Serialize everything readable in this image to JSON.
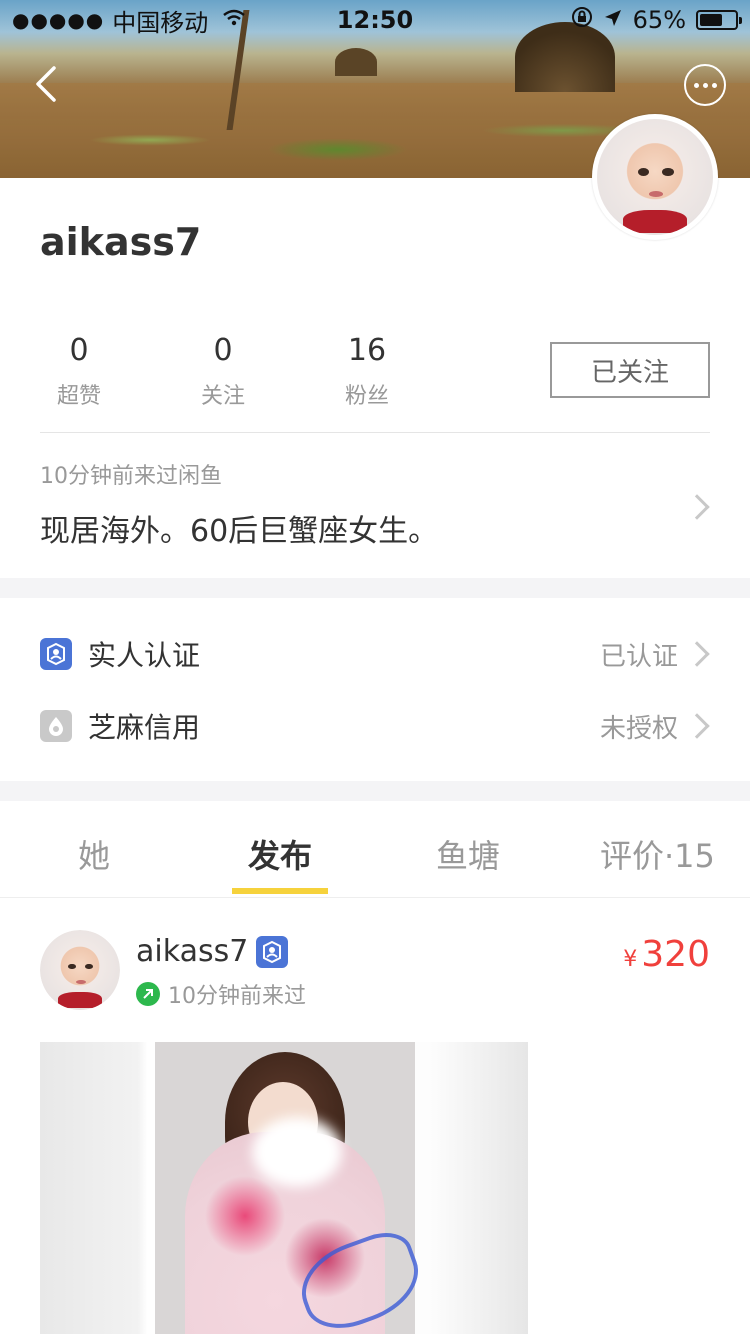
{
  "status_bar": {
    "signal": "●●●●●",
    "carrier": "中国移动",
    "time": "12:50",
    "battery": "65%",
    "battery_level": 0.65
  },
  "profile": {
    "username": "aikass7",
    "stats": [
      {
        "num": "0",
        "label": "超赞"
      },
      {
        "num": "0",
        "label": "关注"
      },
      {
        "num": "16",
        "label": "粉丝"
      }
    ],
    "follow_label": "已关注",
    "last_seen": "10分钟前来过闲鱼",
    "bio": "现居海外。60后巨蟹座女生。"
  },
  "verification": {
    "items": [
      {
        "label": "实人认证",
        "status": "已认证",
        "icon": "real-person-icon",
        "color": "#4b74d6"
      },
      {
        "label": "芝麻信用",
        "status": "未授权",
        "icon": "sesame-credit-icon",
        "color": "#c9c9c9"
      }
    ]
  },
  "tabs": [
    {
      "label": "她",
      "active": false
    },
    {
      "label": "发布",
      "active": true
    },
    {
      "label": "鱼塘",
      "active": false
    },
    {
      "label": "评价·15",
      "active": false
    }
  ],
  "feed": {
    "item": {
      "user": "aikass7",
      "seen": "10分钟前来过",
      "currency": "¥",
      "price": "320",
      "price_color": "#f0403c"
    }
  },
  "accent": "#f6d23c"
}
